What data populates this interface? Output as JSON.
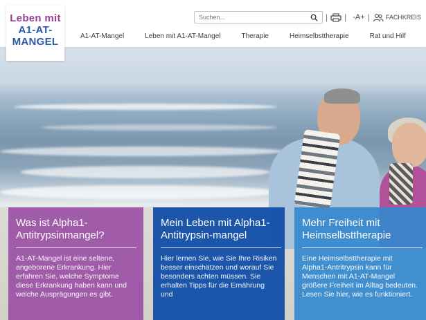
{
  "logo": {
    "lines": [
      "Leben mit",
      "A1-AT-",
      "MANGEL"
    ]
  },
  "search": {
    "placeholder": "Suchen..."
  },
  "utility": {
    "font_size_label": "-A+",
    "fachkreise_label": "FACHKREIS"
  },
  "nav": {
    "items": [
      "A1-AT-Mangel",
      "Leben mit A1-AT-Mangel",
      "Therapie",
      "Heimselbsttherapie",
      "Rat und Hilf"
    ]
  },
  "cards": [
    {
      "title": "Was ist Alpha1-Antitrypsinmangel?",
      "text": "A1-AT-Mangel ist eine seltene, angeborene Erkrankung. Hier erfahren Sie, welche Symptome diese Erkrankung haben kann und welche Ausprägungen es gibt.",
      "color": "#9b50a5"
    },
    {
      "title": "Mein Leben mit Alpha1-Antitrypsin-mangel",
      "text": "Hier lernen Sie, wie Sie Ihre Risiken besser einschätzen und worauf Sie besonders achten müssen. Sie erhalten Tipps für die Ernährung und",
      "color": "#104ea8"
    },
    {
      "title": "Mehr Freiheit mit Heimselbsttherapie",
      "text": "Eine Heimselbsttherapie mit Alpha1-Antritrypsin kann für Menschen mit A1-AT-Mangel größere Freiheit im Alltag bedeuten. Lesen Sie hier, wie es funktioniert.",
      "color": "#3589cf"
    }
  ],
  "icons": [
    "search-icon",
    "print-icon",
    "users-icon"
  ]
}
